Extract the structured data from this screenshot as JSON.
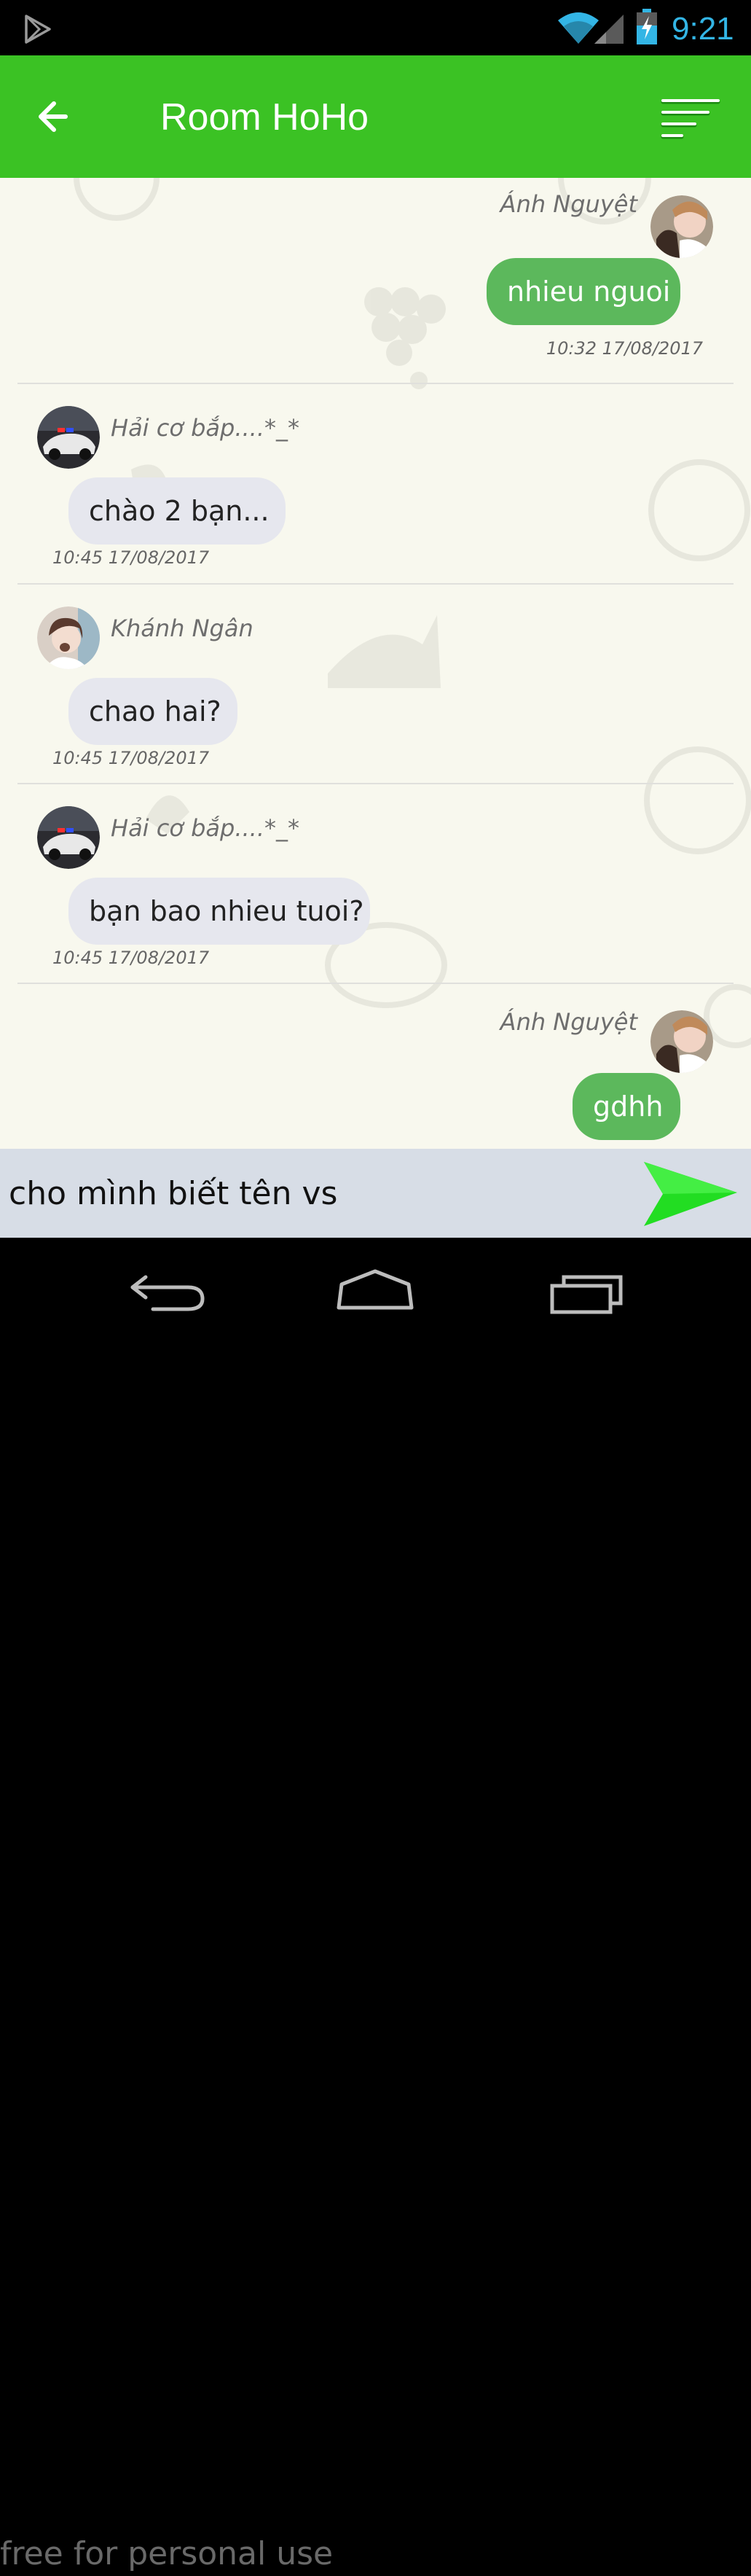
{
  "status_bar": {
    "time": "9:21"
  },
  "app_bar": {
    "title": "Room HoHo"
  },
  "messages": [
    {
      "sender": "Ánh Nguyệt",
      "text": "nhieu nguoi",
      "time": "10:32 17/08/2017",
      "direction": "outgoing"
    },
    {
      "sender": "Hải cơ bắp....*_*",
      "text": "chào 2 bạn...",
      "time": "10:45 17/08/2017",
      "direction": "incoming"
    },
    {
      "sender": "Khánh Ngân",
      "text": "chao hai?",
      "time": "10:45 17/08/2017",
      "direction": "incoming"
    },
    {
      "sender": "Hải cơ bắp....*_*",
      "text": "bạn bao nhieu tuoi?",
      "time": "10:45 17/08/2017",
      "direction": "incoming"
    },
    {
      "sender": "Ánh Nguyệt",
      "text": "gdhh",
      "direction": "outgoing"
    }
  ],
  "composer": {
    "value": "cho mình biết tên vs"
  },
  "watermark": "free for personal use",
  "colors": {
    "app_bar": "#3bc224",
    "outgoing_bubble": "#5cb85c",
    "incoming_bubble": "#e6e7ee",
    "chat_background": "#f8f8ee",
    "send_arrow": "#22dd22",
    "clock": "#33b5e5"
  },
  "icons": {
    "play_store": "play-store-icon",
    "wifi": "wifi-icon",
    "signal": "signal-icon",
    "battery": "battery-charging-icon",
    "back": "arrow-left-icon",
    "menu": "sort-menu-icon",
    "send": "send-arrow-icon",
    "nav_back": "nav-back-icon",
    "nav_home": "nav-home-icon",
    "nav_recents": "nav-recents-icon"
  }
}
